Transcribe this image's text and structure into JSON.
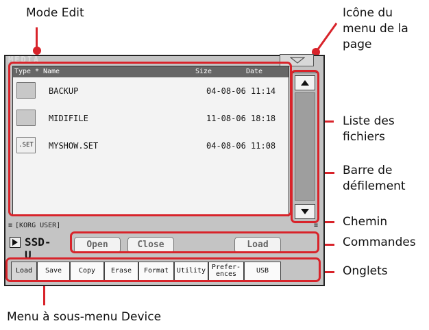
{
  "callouts": {
    "mode_edit": "Mode Edit",
    "page_menu_icon": "Icône du menu de la page",
    "file_list": "Liste des fichiers",
    "scrollbar": "Barre de défilement",
    "path": "Chemin",
    "commands": "Commandes",
    "tabs": "Onglets",
    "device_menu": "Menu à sous-menu Device"
  },
  "screen": {
    "page_title": "MEDIA",
    "columns": {
      "type": "Type",
      "sort_marker": "*",
      "name": "Name",
      "size": "Size",
      "date": "Date"
    },
    "files": [
      {
        "icon": "folder-icon",
        "type_label": "",
        "name": "BACKUP",
        "date": "04-08-06 11:14"
      },
      {
        "icon": "folder-icon",
        "type_label": "",
        "name": "MIDIFILE",
        "date": "11-08-06 18:18"
      },
      {
        "icon": "set-file-icon",
        "type_label": ".SET",
        "name": "MYSHOW.SET",
        "date": "04-08-06 11:08"
      }
    ],
    "path": "[KORG USER]",
    "device": "SSD-U",
    "commands": {
      "open": "Open",
      "close": "Close",
      "load": "Load"
    },
    "tabs": [
      "Load",
      "Save",
      "Copy",
      "Erase",
      "Format",
      "Utility",
      "Prefer-\nences",
      "USB"
    ],
    "active_tab": "Load"
  },
  "colors": {
    "callout_red": "#d8232a",
    "screen_bg": "#c4c4c4",
    "list_bg": "#f3f3f3"
  }
}
